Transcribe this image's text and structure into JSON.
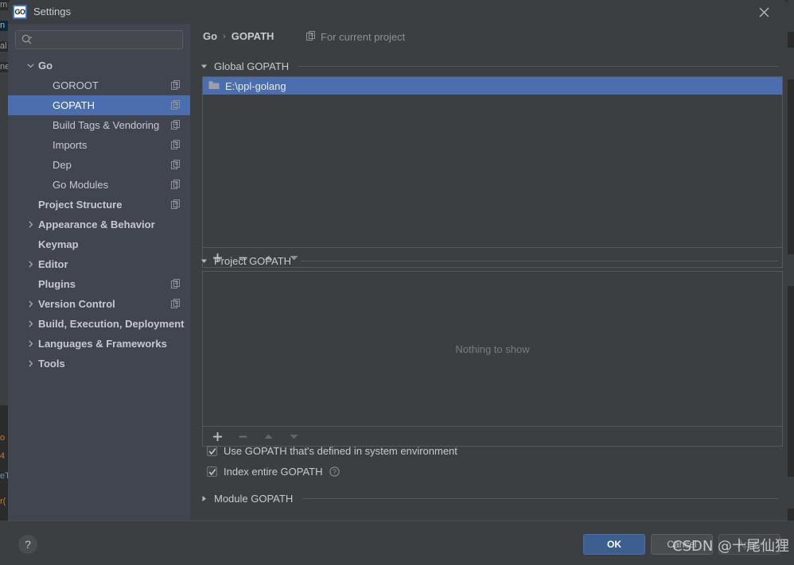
{
  "background": {
    "left_fragments": [
      "m",
      "n",
      "al",
      "ne",
      "o",
      "4",
      "eT",
      "r("
    ],
    "note": "partially visible IDE editor behind the dialog"
  },
  "window": {
    "title": "Settings",
    "app_icon": "go-logo-icon",
    "close_icon": "close-icon"
  },
  "search": {
    "value": "",
    "placeholder": "",
    "icon": "search-icon"
  },
  "sidebar": {
    "items": [
      {
        "label": "Go",
        "indent": 0,
        "bold": true,
        "arrow": "expanded",
        "copy": false,
        "selected": false
      },
      {
        "label": "GOROOT",
        "indent": 1,
        "bold": false,
        "arrow": "none",
        "copy": true,
        "selected": false
      },
      {
        "label": "GOPATH",
        "indent": 1,
        "bold": false,
        "arrow": "none",
        "copy": true,
        "selected": true
      },
      {
        "label": "Build Tags & Vendoring",
        "indent": 1,
        "bold": false,
        "arrow": "none",
        "copy": true,
        "selected": false
      },
      {
        "label": "Imports",
        "indent": 1,
        "bold": false,
        "arrow": "none",
        "copy": true,
        "selected": false
      },
      {
        "label": "Dep",
        "indent": 1,
        "bold": false,
        "arrow": "none",
        "copy": true,
        "selected": false
      },
      {
        "label": "Go Modules",
        "indent": 1,
        "bold": false,
        "arrow": "none",
        "copy": true,
        "selected": false
      },
      {
        "label": "Project Structure",
        "indent": 0,
        "bold": true,
        "arrow": "none",
        "copy": true,
        "selected": false
      },
      {
        "label": "Appearance & Behavior",
        "indent": 0,
        "bold": true,
        "arrow": "collapsed",
        "copy": false,
        "selected": false
      },
      {
        "label": "Keymap",
        "indent": 0,
        "bold": true,
        "arrow": "none",
        "copy": false,
        "selected": false
      },
      {
        "label": "Editor",
        "indent": 0,
        "bold": true,
        "arrow": "collapsed",
        "copy": false,
        "selected": false
      },
      {
        "label": "Plugins",
        "indent": 0,
        "bold": true,
        "arrow": "none",
        "copy": true,
        "selected": false
      },
      {
        "label": "Version Control",
        "indent": 0,
        "bold": true,
        "arrow": "collapsed",
        "copy": true,
        "selected": false
      },
      {
        "label": "Build, Execution, Deployment",
        "indent": 0,
        "bold": true,
        "arrow": "collapsed",
        "copy": false,
        "selected": false
      },
      {
        "label": "Languages & Frameworks",
        "indent": 0,
        "bold": true,
        "arrow": "collapsed",
        "copy": false,
        "selected": false
      },
      {
        "label": "Tools",
        "indent": 0,
        "bold": true,
        "arrow": "collapsed",
        "copy": false,
        "selected": false
      }
    ]
  },
  "content": {
    "breadcrumb": {
      "parent": "Go",
      "separator": "›",
      "current": "GOPATH"
    },
    "for_current_project": {
      "label": "For current project",
      "icon": "copy-settings-icon"
    },
    "global_gopath": {
      "title": "Global GOPATH",
      "expanded": true,
      "rows": [
        {
          "path": "E:\\ppl-golang",
          "icon": "folder-icon",
          "selected": true
        }
      ],
      "toolbar": [
        {
          "name": "add-button",
          "glyph": "+",
          "enabled": true
        },
        {
          "name": "remove-button",
          "glyph": "−",
          "enabled": true
        },
        {
          "name": "move-up-button",
          "glyph": "▲",
          "enabled": true
        },
        {
          "name": "move-down-button",
          "glyph": "▼",
          "enabled": true
        }
      ]
    },
    "project_gopath": {
      "title": "Project GOPATH",
      "expanded": true,
      "empty_message": "Nothing to show",
      "rows": [],
      "toolbar": [
        {
          "name": "add-button",
          "glyph": "+",
          "enabled": true
        },
        {
          "name": "remove-button",
          "glyph": "−",
          "enabled": false
        },
        {
          "name": "move-up-button",
          "glyph": "▲",
          "enabled": false
        },
        {
          "name": "move-down-button",
          "glyph": "▼",
          "enabled": false
        }
      ]
    },
    "checkboxes": [
      {
        "label": "Use GOPATH that's defined in system environment",
        "checked": true,
        "help": false
      },
      {
        "label": "Index entire GOPATH",
        "checked": true,
        "help": true
      }
    ],
    "module_gopath": {
      "title": "Module GOPATH",
      "expanded": false
    }
  },
  "footer": {
    "help_label": "?",
    "ok_label": "OK",
    "cancel_label": "Cancel",
    "apply_label": "Apply"
  },
  "watermark": {
    "text": "CSDN @十尾仙狸"
  },
  "colors": {
    "dialog_bg": "#3c3f41",
    "sidebar_bg": "#414550",
    "selection_blue": "#4b6eaf",
    "accent_button": "#3c5f8f",
    "text_primary": "#c6c9ce",
    "text_muted": "#8d9096",
    "border": "#55585c"
  }
}
